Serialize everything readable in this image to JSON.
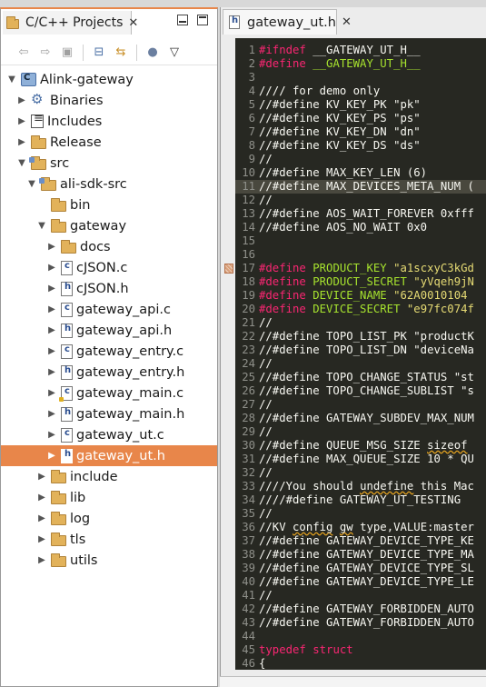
{
  "project_explorer": {
    "title": "C/C++ Projects",
    "toolbar": [
      {
        "icon": "back-arrow-icon"
      },
      {
        "icon": "forward-arrow-icon"
      },
      {
        "icon": "up-folder-icon"
      },
      {
        "icon": "collapse-all-icon"
      },
      {
        "icon": "link-with-editor-icon"
      },
      {
        "icon": "filter-icon"
      },
      {
        "icon": "view-menu-icon"
      }
    ],
    "tree": [
      {
        "label": "Alink-gateway",
        "depth": 0,
        "expanded": true,
        "icon": "project"
      },
      {
        "label": "Binaries",
        "depth": 1,
        "expanded": false,
        "icon": "binaries"
      },
      {
        "label": "Includes",
        "depth": 1,
        "expanded": false,
        "icon": "includes"
      },
      {
        "label": "Release",
        "depth": 1,
        "expanded": false,
        "icon": "folder"
      },
      {
        "label": "src",
        "depth": 1,
        "expanded": true,
        "icon": "srcfolder"
      },
      {
        "label": "ali-sdk-src",
        "depth": 2,
        "expanded": true,
        "icon": "srcfolder"
      },
      {
        "label": "bin",
        "depth": 3,
        "expanded": null,
        "icon": "folder"
      },
      {
        "label": "gateway",
        "depth": 3,
        "expanded": true,
        "icon": "folder"
      },
      {
        "label": "docs",
        "depth": 4,
        "expanded": false,
        "icon": "folder"
      },
      {
        "label": "cJSON.c",
        "depth": 4,
        "expanded": false,
        "icon": "cfile"
      },
      {
        "label": "cJSON.h",
        "depth": 4,
        "expanded": false,
        "icon": "hfile"
      },
      {
        "label": "gateway_api.c",
        "depth": 4,
        "expanded": false,
        "icon": "cfile"
      },
      {
        "label": "gateway_api.h",
        "depth": 4,
        "expanded": false,
        "icon": "hfile"
      },
      {
        "label": "gateway_entry.c",
        "depth": 4,
        "expanded": false,
        "icon": "cfile"
      },
      {
        "label": "gateway_entry.h",
        "depth": 4,
        "expanded": false,
        "icon": "hfile"
      },
      {
        "label": "gateway_main.c",
        "depth": 4,
        "expanded": false,
        "icon": "cfile-warn"
      },
      {
        "label": "gateway_main.h",
        "depth": 4,
        "expanded": false,
        "icon": "hfile"
      },
      {
        "label": "gateway_ut.c",
        "depth": 4,
        "expanded": false,
        "icon": "cfile"
      },
      {
        "label": "gateway_ut.h",
        "depth": 4,
        "expanded": false,
        "icon": "hfile",
        "selected": true
      },
      {
        "label": "include",
        "depth": 3,
        "expanded": false,
        "icon": "folder"
      },
      {
        "label": "lib",
        "depth": 3,
        "expanded": false,
        "icon": "folder"
      },
      {
        "label": "log",
        "depth": 3,
        "expanded": false,
        "icon": "folder"
      },
      {
        "label": "tls",
        "depth": 3,
        "expanded": false,
        "icon": "folder"
      },
      {
        "label": "utils",
        "depth": 3,
        "expanded": false,
        "icon": "folder"
      }
    ]
  },
  "editor": {
    "tab_title": "gateway_ut.h",
    "highlighted_line": 11,
    "marked_line": 17,
    "lines": [
      {
        "n": "1",
        "tokens": [
          [
            "kw",
            "#ifndef"
          ],
          [
            "plain",
            " __GATEWAY_UT_H__"
          ]
        ]
      },
      {
        "n": "2",
        "tokens": [
          [
            "kw",
            "#define"
          ],
          [
            "macro",
            " __GATEWAY_UT_H__"
          ]
        ]
      },
      {
        "n": "3",
        "tokens": []
      },
      {
        "n": "4",
        "tokens": [
          [
            "cmt",
            "//// for demo only"
          ]
        ]
      },
      {
        "n": "5",
        "tokens": [
          [
            "cmt",
            "//#define KV_KEY_PK \"pk\""
          ]
        ]
      },
      {
        "n": "6",
        "tokens": [
          [
            "cmt",
            "//#define KV_KEY_PS \"ps\""
          ]
        ]
      },
      {
        "n": "7",
        "tokens": [
          [
            "cmt",
            "//#define KV_KEY_DN \"dn\""
          ]
        ]
      },
      {
        "n": "8",
        "tokens": [
          [
            "cmt",
            "//#define KV_KEY_DS \"ds\""
          ]
        ]
      },
      {
        "n": "9",
        "tokens": [
          [
            "cmt",
            "//"
          ]
        ]
      },
      {
        "n": "10",
        "tokens": [
          [
            "cmt",
            "//#define MAX_KEY_LEN (6)"
          ]
        ]
      },
      {
        "n": "11",
        "tokens": [
          [
            "cmt",
            "//#define MAX_DEVICES_META_NUM ("
          ]
        ]
      },
      {
        "n": "12",
        "tokens": [
          [
            "cmt",
            "//"
          ]
        ]
      },
      {
        "n": "13",
        "tokens": [
          [
            "cmt",
            "//#define AOS_WAIT_FOREVER 0xfff"
          ]
        ]
      },
      {
        "n": "14",
        "tokens": [
          [
            "cmt",
            "//#define AOS_NO_WAIT 0x0"
          ]
        ]
      },
      {
        "n": "15",
        "tokens": []
      },
      {
        "n": "16",
        "tokens": []
      },
      {
        "n": "17",
        "tokens": [
          [
            "kw",
            "#define"
          ],
          [
            "plain",
            " "
          ],
          [
            "macro",
            "PRODUCT_KEY"
          ],
          [
            "plain",
            " "
          ],
          [
            "str",
            "\"a1scxyC3kGd"
          ]
        ]
      },
      {
        "n": "18",
        "tokens": [
          [
            "kw",
            "#define"
          ],
          [
            "plain",
            " "
          ],
          [
            "macro",
            "PRODUCT_SECRET"
          ],
          [
            "plain",
            " "
          ],
          [
            "str",
            "\"yVqeh9jN"
          ]
        ]
      },
      {
        "n": "19",
        "tokens": [
          [
            "kw",
            "#define"
          ],
          [
            "plain",
            " "
          ],
          [
            "macro",
            "DEVICE_NAME"
          ],
          [
            "plain",
            " "
          ],
          [
            "str",
            "\"62A0010104"
          ]
        ]
      },
      {
        "n": "20",
        "tokens": [
          [
            "kw",
            "#define"
          ],
          [
            "plain",
            " "
          ],
          [
            "macro",
            "DEVICE_SECRET"
          ],
          [
            "plain",
            " "
          ],
          [
            "str",
            "\"e97fc074f"
          ]
        ]
      },
      {
        "n": "21",
        "tokens": [
          [
            "cmt",
            "//"
          ]
        ]
      },
      {
        "n": "22",
        "tokens": [
          [
            "cmt",
            "//#define TOPO_LIST_PK \"productK"
          ]
        ]
      },
      {
        "n": "23",
        "tokens": [
          [
            "cmt",
            "//#define TOPO_LIST_DN \"deviceNa"
          ]
        ]
      },
      {
        "n": "24",
        "tokens": [
          [
            "cmt",
            "//"
          ]
        ]
      },
      {
        "n": "25",
        "tokens": [
          [
            "cmt",
            "//#define TOPO_CHANGE_STATUS \"st"
          ]
        ]
      },
      {
        "n": "26",
        "tokens": [
          [
            "cmt",
            "//#define TOPO_CHANGE_SUBLIST \"s"
          ]
        ]
      },
      {
        "n": "27",
        "tokens": [
          [
            "cmt",
            "//"
          ]
        ]
      },
      {
        "n": "28",
        "tokens": [
          [
            "cmt",
            "//#define GATEWAY_SUBDEV_MAX_NUM"
          ]
        ]
      },
      {
        "n": "29",
        "tokens": [
          [
            "cmt",
            "//"
          ]
        ]
      },
      {
        "n": "30",
        "tokens": [
          [
            "cmt",
            "//#define QUEUE_MSG_SIZE "
          ],
          [
            "sq",
            "sizeof"
          ]
        ]
      },
      {
        "n": "31",
        "tokens": [
          [
            "cmt",
            "//#define MAX_QUEUE_SIZE 10 * QU"
          ]
        ]
      },
      {
        "n": "32",
        "tokens": [
          [
            "cmt",
            "//"
          ]
        ]
      },
      {
        "n": "33",
        "tokens": [
          [
            "cmt",
            "////You should "
          ],
          [
            "sq",
            "undefine"
          ],
          [
            "cmt",
            " this Mac"
          ]
        ]
      },
      {
        "n": "34",
        "tokens": [
          [
            "cmt",
            "////#define GATEWAY_UT_TESTING"
          ]
        ]
      },
      {
        "n": "35",
        "tokens": [
          [
            "cmt",
            "//"
          ]
        ]
      },
      {
        "n": "36",
        "tokens": [
          [
            "cmt",
            "//KV "
          ],
          [
            "sq",
            "config"
          ],
          [
            "cmt",
            " "
          ],
          [
            "sq",
            "gw"
          ],
          [
            "cmt",
            " type,VALUE:master"
          ]
        ]
      },
      {
        "n": "37",
        "tokens": [
          [
            "cmt",
            "//#define GATEWAY_DEVICE_TYPE_KE"
          ]
        ]
      },
      {
        "n": "38",
        "tokens": [
          [
            "cmt",
            "//#define GATEWAY_DEVICE_TYPE_MA"
          ]
        ]
      },
      {
        "n": "39",
        "tokens": [
          [
            "cmt",
            "//#define GATEWAY_DEVICE_TYPE_SL"
          ]
        ]
      },
      {
        "n": "40",
        "tokens": [
          [
            "cmt",
            "//#define GATEWAY_DEVICE_TYPE_LE"
          ]
        ]
      },
      {
        "n": "41",
        "tokens": [
          [
            "cmt",
            "//"
          ]
        ]
      },
      {
        "n": "42",
        "tokens": [
          [
            "cmt",
            "//#define GATEWAY_FORBIDDEN_AUTO"
          ]
        ]
      },
      {
        "n": "43",
        "tokens": [
          [
            "cmt",
            "//#define GATEWAY_FORBIDDEN_AUTO"
          ]
        ]
      },
      {
        "n": "44",
        "tokens": []
      },
      {
        "n": "45",
        "tokens": [
          [
            "kw",
            "typedef"
          ],
          [
            "plain",
            " "
          ],
          [
            "kw",
            "struct"
          ]
        ]
      },
      {
        "n": "46",
        "tokens": [
          [
            "plain",
            "{"
          ]
        ]
      }
    ]
  },
  "colors": {
    "accent": "#e8864a",
    "editor_bg": "#272822",
    "keyword": "#f92672",
    "macro": "#a6e22e",
    "string": "#e6db74"
  }
}
